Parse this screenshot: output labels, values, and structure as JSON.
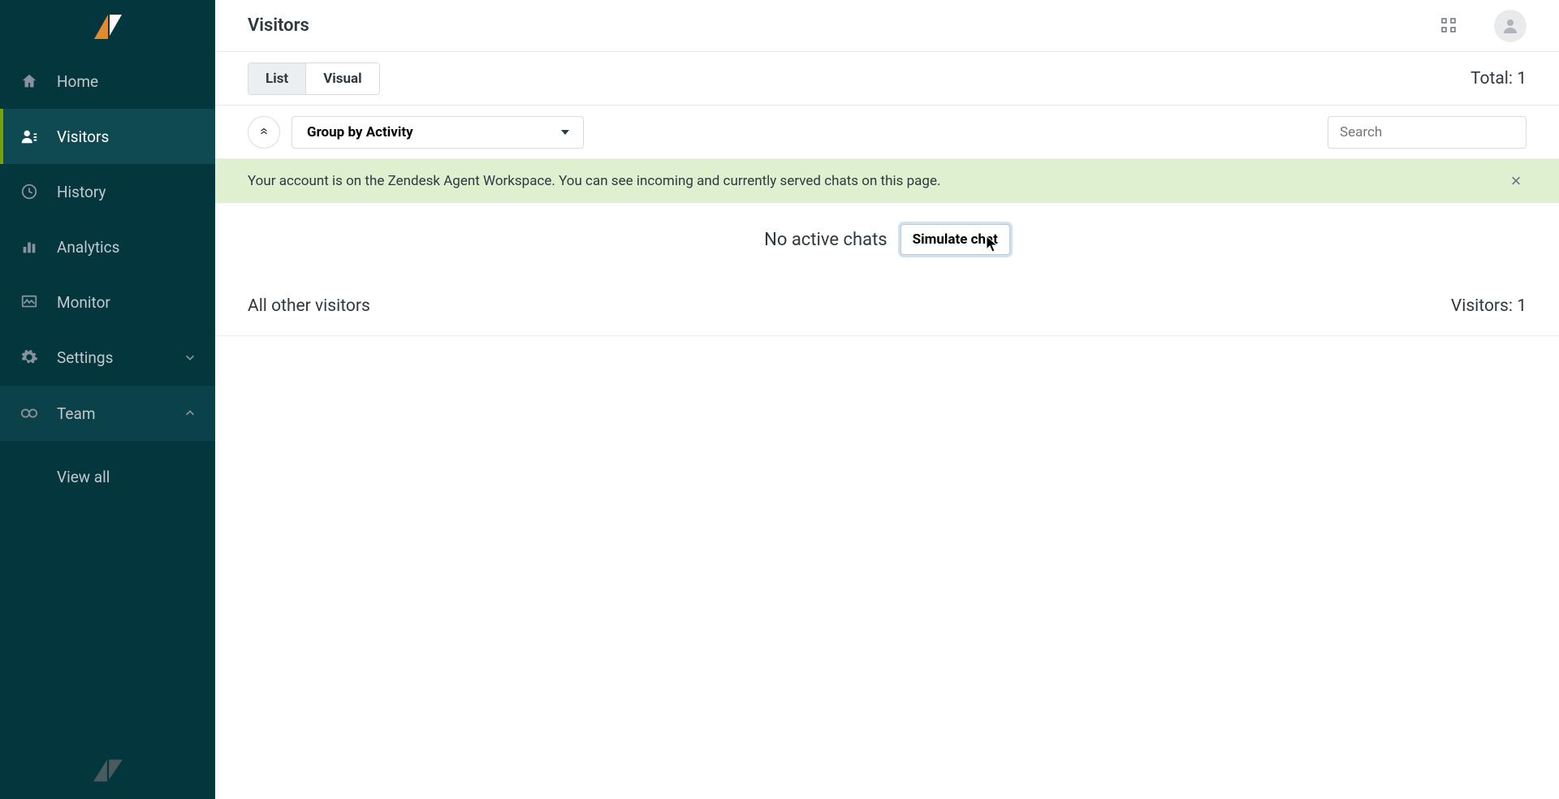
{
  "header": {
    "title": "Visitors"
  },
  "sidebar": {
    "items": [
      {
        "label": "Home",
        "icon": "home"
      },
      {
        "label": "Visitors",
        "icon": "visitors"
      },
      {
        "label": "History",
        "icon": "history"
      },
      {
        "label": "Analytics",
        "icon": "analytics"
      },
      {
        "label": "Monitor",
        "icon": "monitor"
      },
      {
        "label": "Settings",
        "icon": "settings"
      },
      {
        "label": "Team",
        "icon": "team"
      }
    ],
    "sub": {
      "view_all": "View all"
    }
  },
  "toolbar": {
    "tabs": {
      "list": "List",
      "visual": "Visual"
    },
    "total_label": "Total:",
    "total_value": "1"
  },
  "filter": {
    "group_label": "Group by Activity",
    "search_placeholder": "Search"
  },
  "banner": {
    "text": "Your account is on the Zendesk Agent Workspace. You can see incoming and currently served chats on this page."
  },
  "empty": {
    "text": "No active chats",
    "simulate_label": "Simulate chat"
  },
  "section": {
    "title": "All other visitors",
    "count_label": "Visitors:",
    "count_value": "1"
  }
}
